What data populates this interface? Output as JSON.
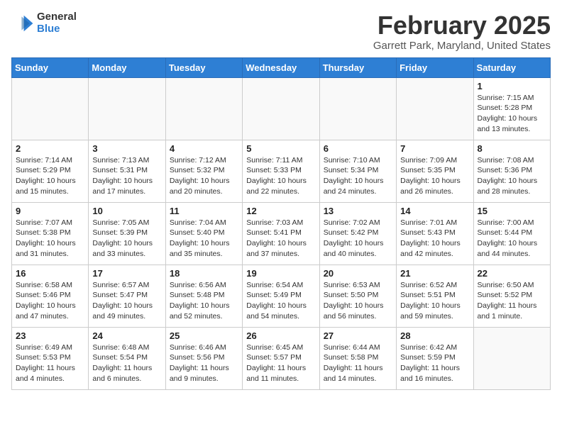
{
  "header": {
    "logo_general": "General",
    "logo_blue": "Blue",
    "month_title": "February 2025",
    "location": "Garrett Park, Maryland, United States"
  },
  "weekdays": [
    "Sunday",
    "Monday",
    "Tuesday",
    "Wednesday",
    "Thursday",
    "Friday",
    "Saturday"
  ],
  "weeks": [
    [
      {
        "num": "",
        "info": ""
      },
      {
        "num": "",
        "info": ""
      },
      {
        "num": "",
        "info": ""
      },
      {
        "num": "",
        "info": ""
      },
      {
        "num": "",
        "info": ""
      },
      {
        "num": "",
        "info": ""
      },
      {
        "num": "1",
        "info": "Sunrise: 7:15 AM\nSunset: 5:28 PM\nDaylight: 10 hours\nand 13 minutes."
      }
    ],
    [
      {
        "num": "2",
        "info": "Sunrise: 7:14 AM\nSunset: 5:29 PM\nDaylight: 10 hours\nand 15 minutes."
      },
      {
        "num": "3",
        "info": "Sunrise: 7:13 AM\nSunset: 5:31 PM\nDaylight: 10 hours\nand 17 minutes."
      },
      {
        "num": "4",
        "info": "Sunrise: 7:12 AM\nSunset: 5:32 PM\nDaylight: 10 hours\nand 20 minutes."
      },
      {
        "num": "5",
        "info": "Sunrise: 7:11 AM\nSunset: 5:33 PM\nDaylight: 10 hours\nand 22 minutes."
      },
      {
        "num": "6",
        "info": "Sunrise: 7:10 AM\nSunset: 5:34 PM\nDaylight: 10 hours\nand 24 minutes."
      },
      {
        "num": "7",
        "info": "Sunrise: 7:09 AM\nSunset: 5:35 PM\nDaylight: 10 hours\nand 26 minutes."
      },
      {
        "num": "8",
        "info": "Sunrise: 7:08 AM\nSunset: 5:36 PM\nDaylight: 10 hours\nand 28 minutes."
      }
    ],
    [
      {
        "num": "9",
        "info": "Sunrise: 7:07 AM\nSunset: 5:38 PM\nDaylight: 10 hours\nand 31 minutes."
      },
      {
        "num": "10",
        "info": "Sunrise: 7:05 AM\nSunset: 5:39 PM\nDaylight: 10 hours\nand 33 minutes."
      },
      {
        "num": "11",
        "info": "Sunrise: 7:04 AM\nSunset: 5:40 PM\nDaylight: 10 hours\nand 35 minutes."
      },
      {
        "num": "12",
        "info": "Sunrise: 7:03 AM\nSunset: 5:41 PM\nDaylight: 10 hours\nand 37 minutes."
      },
      {
        "num": "13",
        "info": "Sunrise: 7:02 AM\nSunset: 5:42 PM\nDaylight: 10 hours\nand 40 minutes."
      },
      {
        "num": "14",
        "info": "Sunrise: 7:01 AM\nSunset: 5:43 PM\nDaylight: 10 hours\nand 42 minutes."
      },
      {
        "num": "15",
        "info": "Sunrise: 7:00 AM\nSunset: 5:44 PM\nDaylight: 10 hours\nand 44 minutes."
      }
    ],
    [
      {
        "num": "16",
        "info": "Sunrise: 6:58 AM\nSunset: 5:46 PM\nDaylight: 10 hours\nand 47 minutes."
      },
      {
        "num": "17",
        "info": "Sunrise: 6:57 AM\nSunset: 5:47 PM\nDaylight: 10 hours\nand 49 minutes."
      },
      {
        "num": "18",
        "info": "Sunrise: 6:56 AM\nSunset: 5:48 PM\nDaylight: 10 hours\nand 52 minutes."
      },
      {
        "num": "19",
        "info": "Sunrise: 6:54 AM\nSunset: 5:49 PM\nDaylight: 10 hours\nand 54 minutes."
      },
      {
        "num": "20",
        "info": "Sunrise: 6:53 AM\nSunset: 5:50 PM\nDaylight: 10 hours\nand 56 minutes."
      },
      {
        "num": "21",
        "info": "Sunrise: 6:52 AM\nSunset: 5:51 PM\nDaylight: 10 hours\nand 59 minutes."
      },
      {
        "num": "22",
        "info": "Sunrise: 6:50 AM\nSunset: 5:52 PM\nDaylight: 11 hours\nand 1 minute."
      }
    ],
    [
      {
        "num": "23",
        "info": "Sunrise: 6:49 AM\nSunset: 5:53 PM\nDaylight: 11 hours\nand 4 minutes."
      },
      {
        "num": "24",
        "info": "Sunrise: 6:48 AM\nSunset: 5:54 PM\nDaylight: 11 hours\nand 6 minutes."
      },
      {
        "num": "25",
        "info": "Sunrise: 6:46 AM\nSunset: 5:56 PM\nDaylight: 11 hours\nand 9 minutes."
      },
      {
        "num": "26",
        "info": "Sunrise: 6:45 AM\nSunset: 5:57 PM\nDaylight: 11 hours\nand 11 minutes."
      },
      {
        "num": "27",
        "info": "Sunrise: 6:44 AM\nSunset: 5:58 PM\nDaylight: 11 hours\nand 14 minutes."
      },
      {
        "num": "28",
        "info": "Sunrise: 6:42 AM\nSunset: 5:59 PM\nDaylight: 11 hours\nand 16 minutes."
      },
      {
        "num": "",
        "info": ""
      }
    ]
  ]
}
